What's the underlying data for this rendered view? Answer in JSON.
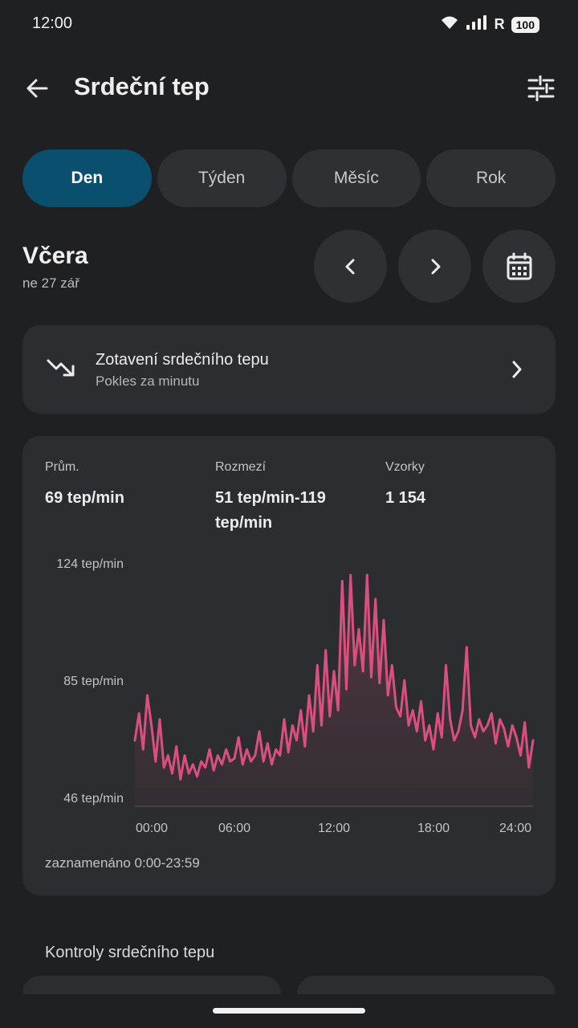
{
  "status": {
    "time": "12:00",
    "network_label": "R",
    "battery": "100"
  },
  "header": {
    "title": "Srdeční tep",
    "back_icon": "arrow-back-icon",
    "filter_icon": "tune-icon"
  },
  "tabs": [
    {
      "label": "Den",
      "active": true
    },
    {
      "label": "Týden",
      "active": false
    },
    {
      "label": "Měsíc",
      "active": false
    },
    {
      "label": "Rok",
      "active": false
    }
  ],
  "date": {
    "title": "Včera",
    "subtitle": "ne 27 zář"
  },
  "recovery": {
    "title": "Zotavení srdečního tepu",
    "subtitle": "Pokles za minutu"
  },
  "stats": {
    "avg_label": "Prům.",
    "avg_value": "69 tep/min",
    "range_label": "Rozmezí",
    "range_value": "51 tep/min-119 tep/min",
    "samples_label": "Vzorky",
    "samples_value": "1 154"
  },
  "chart_data": {
    "type": "line",
    "y_tick_labels": [
      "124 tep/min",
      "85 tep/min",
      "46 tep/min"
    ],
    "y_ticks": [
      124,
      85,
      46
    ],
    "ylim": [
      46,
      124
    ],
    "x_tick_labels": [
      "00:00",
      "06:00",
      "12:00",
      "18:00",
      "24:00"
    ],
    "x_ticks": [
      0,
      6,
      12,
      18,
      24
    ],
    "xlim": [
      0,
      24
    ],
    "color": "#d9507f",
    "x": [
      0,
      0.25,
      0.5,
      0.75,
      1,
      1.25,
      1.5,
      1.75,
      2,
      2.25,
      2.5,
      2.75,
      3,
      3.25,
      3.5,
      3.75,
      4,
      4.25,
      4.5,
      4.75,
      5,
      5.25,
      5.5,
      5.75,
      6,
      6.25,
      6.5,
      6.75,
      7,
      7.25,
      7.5,
      7.75,
      8,
      8.25,
      8.5,
      8.75,
      9,
      9.25,
      9.5,
      9.75,
      10,
      10.25,
      10.5,
      10.75,
      11,
      11.25,
      11.5,
      11.75,
      12,
      12.25,
      12.5,
      12.75,
      13,
      13.25,
      13.5,
      13.75,
      14,
      14.25,
      14.5,
      14.75,
      15,
      15.25,
      15.5,
      15.75,
      16,
      16.25,
      16.5,
      16.75,
      17,
      17.25,
      17.5,
      17.75,
      18,
      18.25,
      18.5,
      18.75,
      19,
      19.25,
      19.5,
      19.75,
      20,
      20.25,
      20.5,
      20.75,
      21,
      21.25,
      21.5,
      21.75,
      22,
      22.25,
      22.5,
      22.75,
      23,
      23.25,
      23.5,
      23.75,
      24
    ],
    "y": [
      65,
      74,
      62,
      80,
      70,
      58,
      72,
      56,
      60,
      54,
      63,
      52,
      60,
      54,
      57,
      53,
      58,
      56,
      62,
      55,
      60,
      57,
      62,
      58,
      59,
      66,
      57,
      62,
      58,
      60,
      68,
      58,
      64,
      57,
      62,
      60,
      72,
      61,
      70,
      65,
      75,
      63,
      80,
      68,
      90,
      70,
      95,
      73,
      88,
      75,
      118,
      82,
      120,
      90,
      102,
      88,
      120,
      86,
      112,
      84,
      105,
      80,
      90,
      76,
      73,
      85,
      70,
      75,
      68,
      78,
      65,
      70,
      62,
      74,
      66,
      90,
      72,
      65,
      68,
      75,
      96,
      70,
      66,
      72,
      68,
      70,
      74,
      64,
      72,
      69,
      63,
      70,
      66,
      60,
      71,
      56,
      65
    ]
  },
  "recorded": "zaznamenáno 0:00-23:59",
  "checks": {
    "heading": "Kontroly srdečního tepu"
  }
}
